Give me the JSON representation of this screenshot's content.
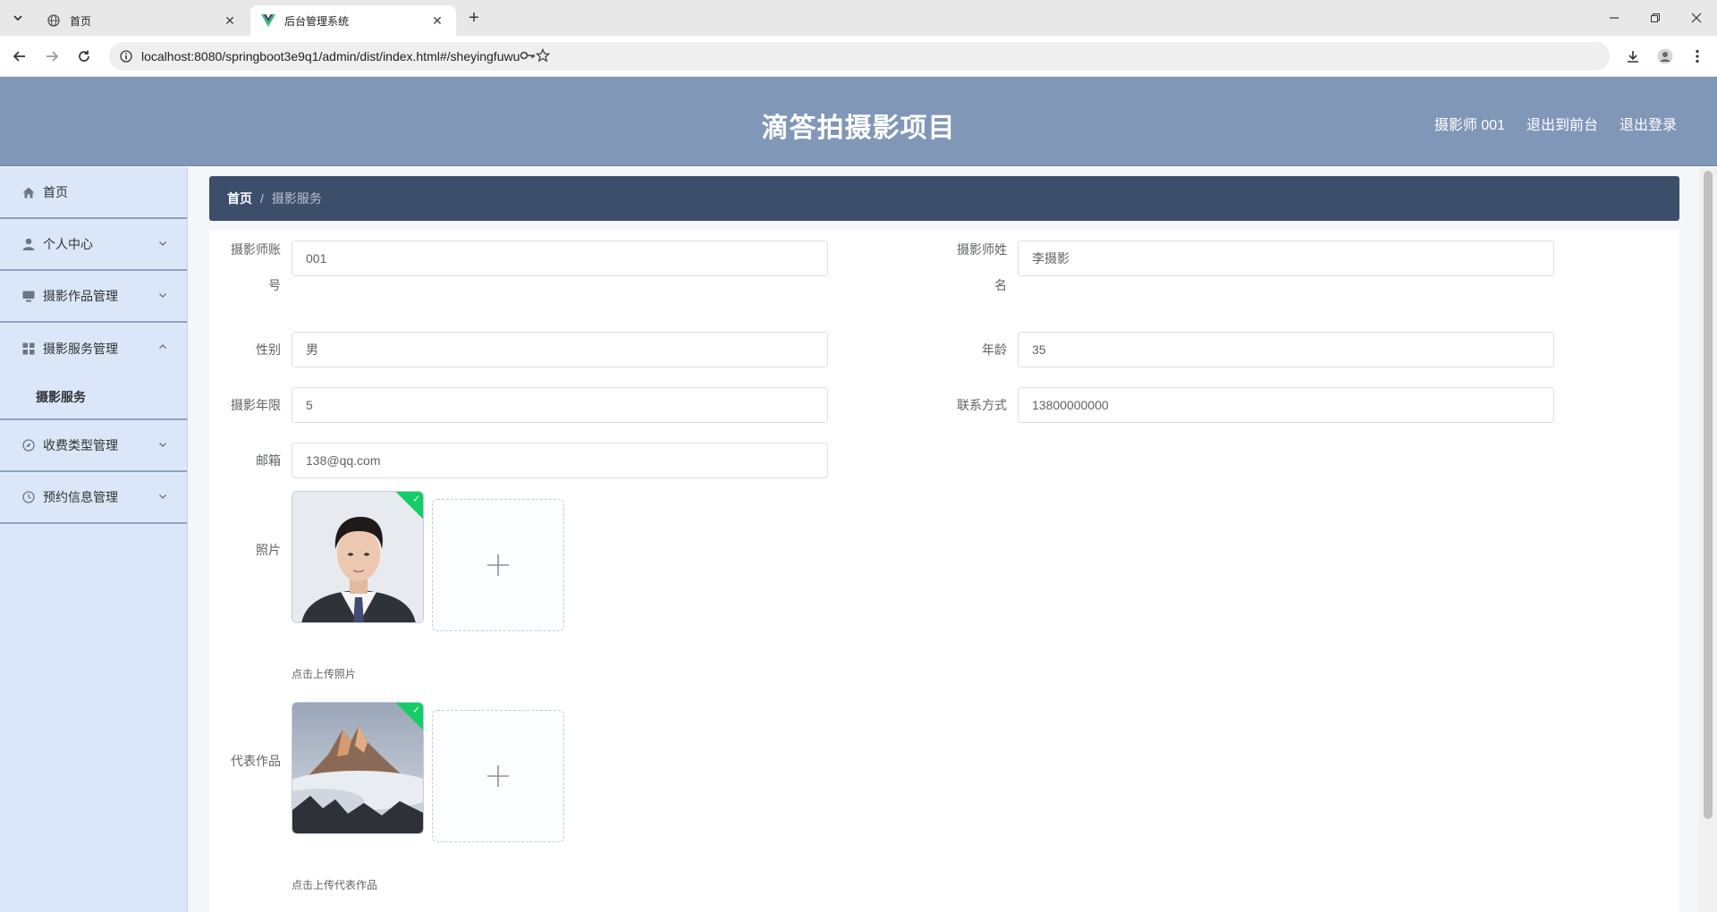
{
  "browser": {
    "tabs": [
      {
        "title": "首页",
        "active": false
      },
      {
        "title": "后台管理系统",
        "active": true
      }
    ],
    "url": "localhost:8080/springboot3e9q1/admin/dist/index.html#/sheyingfuwu"
  },
  "header": {
    "title": "滴答拍摄影项目",
    "user": "摄影师 001",
    "exit_front": "退出到前台",
    "logout": "退出登录"
  },
  "sidebar": {
    "items": [
      {
        "label": "首页",
        "icon": "home-icon"
      },
      {
        "label": "个人中心",
        "icon": "user-icon"
      },
      {
        "label": "摄影作品管理",
        "icon": "monitor-icon"
      },
      {
        "label": "摄影服务管理",
        "icon": "grid-icon",
        "expanded": true
      },
      {
        "label": "收费类型管理",
        "icon": "compass-icon"
      },
      {
        "label": "预约信息管理",
        "icon": "clock-icon"
      }
    ],
    "sub_item": "摄影服务"
  },
  "breadcrumb": {
    "home": "首页",
    "separator": "/",
    "current": "摄影服务"
  },
  "form": {
    "account_label_1": "摄影师账",
    "account_label_2": "号",
    "account_value": "001",
    "name_label_1": "摄影师姓",
    "name_label_2": "名",
    "name_value": "李摄影",
    "gender_label": "性别",
    "gender_value": "男",
    "age_label": "年龄",
    "age_value": "35",
    "years_label": "摄影年限",
    "years_value": "5",
    "contact_label": "联系方式",
    "contact_value": "13800000000",
    "email_label": "邮箱",
    "email_value": "138@qq.com",
    "photo_label": "照片",
    "photo_tip": "点击上传照片",
    "works_label": "代表作品",
    "works_tip": "点击上传代表作品"
  },
  "colors": {
    "header_bg": "#8097b8",
    "sidebar_bg": "#dbe7f8",
    "breadcrumb_bg": "#3d4e6b",
    "upload_success": "#13ce66"
  }
}
